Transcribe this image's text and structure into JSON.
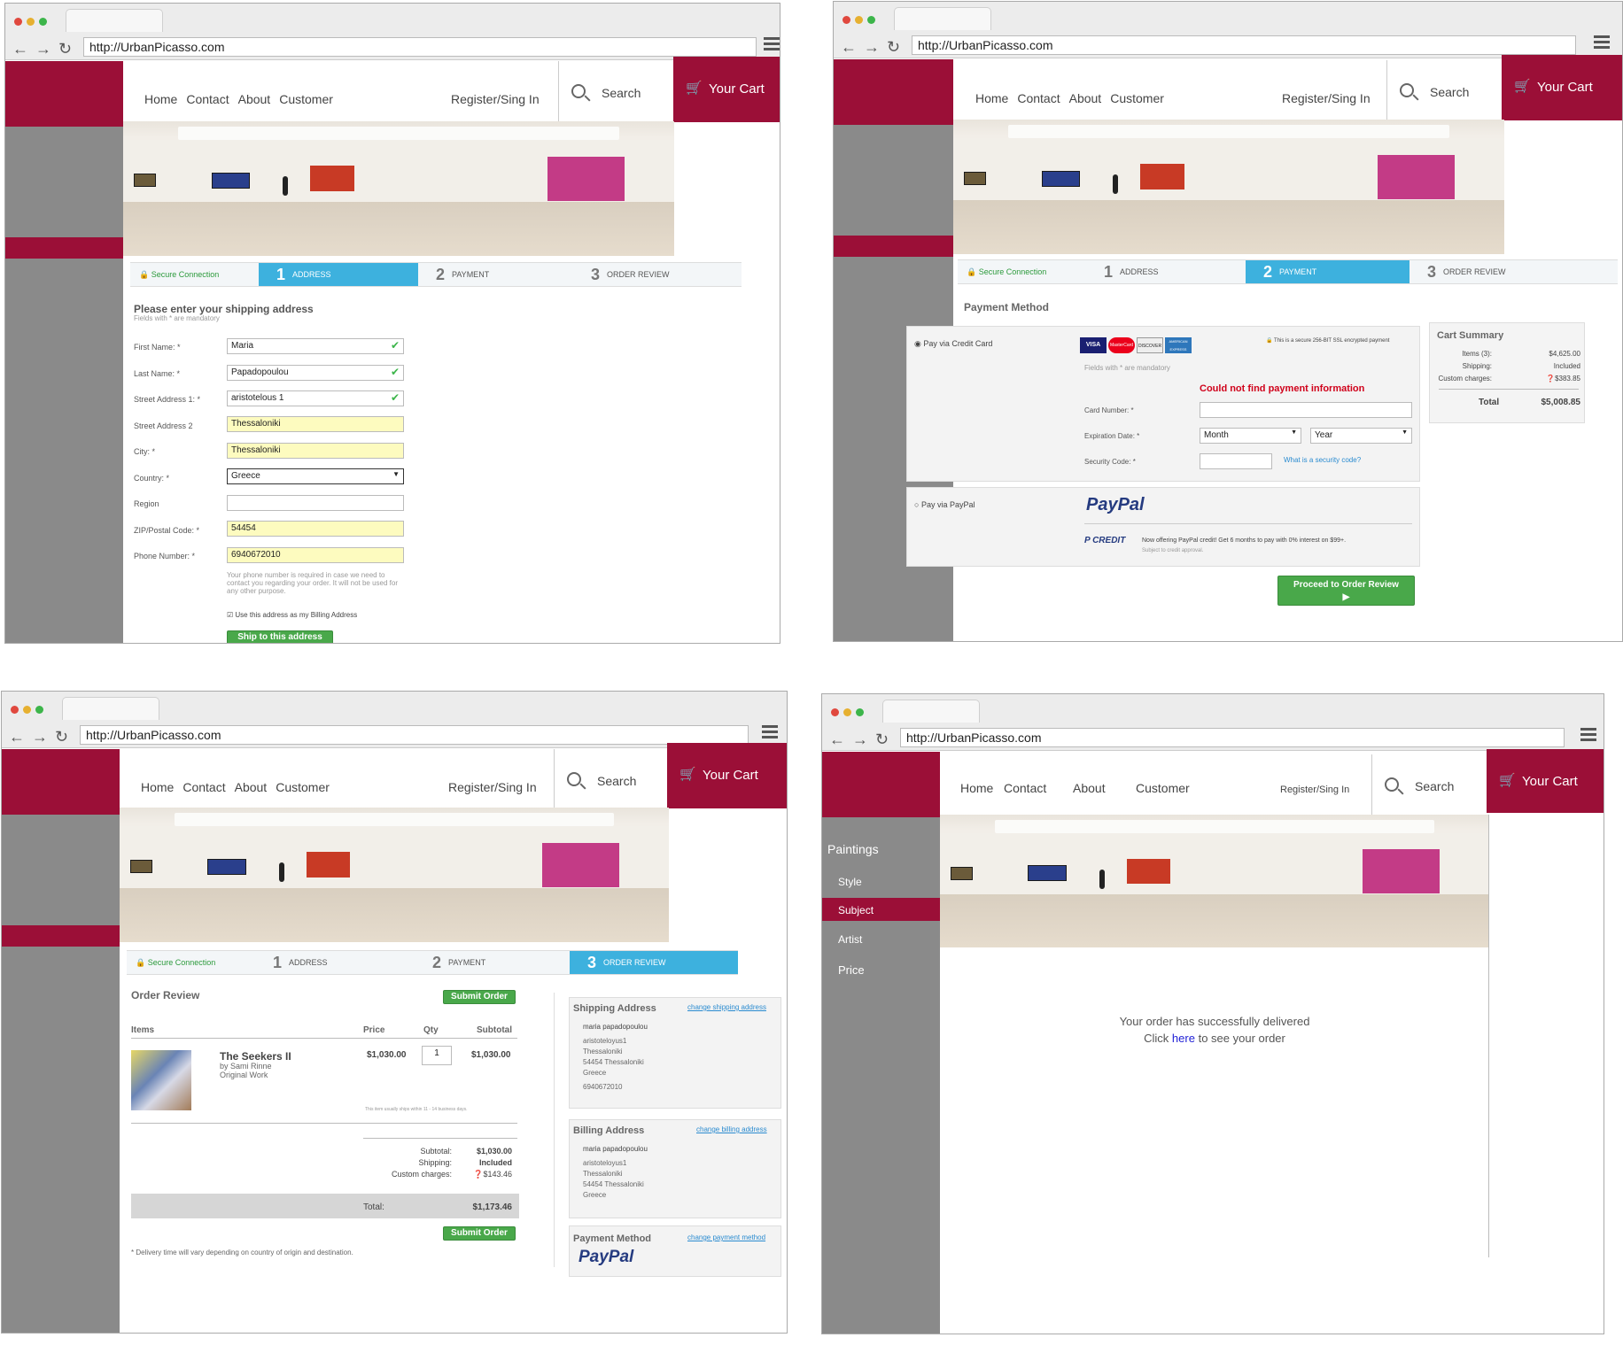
{
  "browser": {
    "url": "http://UrbanPicasso.com"
  },
  "site": {
    "nav": [
      "Home",
      "Contact",
      "About",
      "Customer"
    ],
    "register": "Register/Sing In",
    "search": "Search",
    "cart": "Your Cart",
    "cart_icon": "cart-icon",
    "brand_color": "#9b0f37",
    "accent_color": "#3db1de"
  },
  "steps": {
    "secure": "Secure Connection",
    "s1": "1",
    "l1": "ADDRESS",
    "s2": "2",
    "l2": "PAYMENT",
    "s3": "3",
    "l3": "ORDER REVIEW"
  },
  "address": {
    "title": "Please enter your shipping address",
    "subtitle": "Fields with * are mandatory",
    "fields": [
      {
        "label": "First Name: *",
        "value": "Maria"
      },
      {
        "label": "Last Name: *",
        "value": "Papadopoulou"
      },
      {
        "label": "Street Address 1: *",
        "value": "aristotelous 1"
      },
      {
        "label": "Street Address 2",
        "value": "Thessaloniki"
      },
      {
        "label": "City: *",
        "value": "Thessaloniki"
      },
      {
        "label": "Country: *",
        "value": "Greece"
      },
      {
        "label": "Region",
        "value": ""
      },
      {
        "label": "ZIP/Postal Code: *",
        "value": "54454"
      },
      {
        "label": "Phone Number: *",
        "value": "6940672010"
      }
    ],
    "phone_note": "Your phone number is required in case we need to contact you regarding your order. It will not be used for any other purpose.",
    "billing_check": "Use this address as my Billing Address",
    "ship_button": "Ship to this address"
  },
  "payment": {
    "title": "Payment Method",
    "credit_card": "Pay via Credit Card",
    "secure_note": "This is a secure 256-BIT SSL encrypted payment",
    "mandatory": "Fields with * are mandatory",
    "error": "Could not find payment information",
    "card_number": "Card Number: *",
    "expiration": "Expiration Date: *",
    "month": "Month",
    "year": "Year",
    "security": "Security Code: *",
    "security_link": "What is a security code?",
    "paypal": "Pay via PayPal",
    "paypal_logo": "PayPal",
    "paypal_credit": "CREDIT",
    "paypal_offer": "Now offering PayPal credit! Get 6 months to pay with 0% interest on $99+.",
    "paypal_sub": "Subject to credit approval.",
    "proceed": "Proceed to Order Review",
    "cards": [
      "VISA",
      "MasterCard",
      "DISCOVER",
      "AMERICAN EXPRESS"
    ]
  },
  "summary": {
    "title": "Cart Summary",
    "items_label": "Items (3):",
    "items_value": "$4,625.00",
    "shipping_label": "Shipping:",
    "shipping_value": "Included",
    "custom_label": "Custom charges:",
    "custom_value": "$383.85",
    "total_label": "Total",
    "total_value": "$5,008.85"
  },
  "review": {
    "title": "Order Review",
    "submit": "Submit Order",
    "col_items": "Items",
    "col_price": "Price",
    "col_qty": "Qty",
    "col_subtotal": "Subtotal",
    "item_name": "The Seekers II",
    "item_by": "by Sami Rinne",
    "item_kind": "Original Work",
    "item_price": "$1,030.00",
    "item_qty": "1",
    "item_subtotal": "$1,030.00",
    "ship_note": "This item usually ships within 11 - 14 business days.",
    "subtotal_label": "Subtotal:",
    "subtotal_value": "$1,030.00",
    "shipping_label": "Shipping:",
    "shipping_value": "Included",
    "custom_label": "Custom charges:",
    "custom_value": "$143.46",
    "total_label": "Total:",
    "total_value": "$1,173.46",
    "delivery_note": "* Delivery time will vary depending on country of origin and destination.",
    "ship_addr_title": "Shipping Address",
    "ship_addr_change": "change shipping address",
    "ship_addr_lines": [
      "maria papadopoulou",
      "aristoteloyus1",
      "Thessaloniki",
      "54454  Thessaloniki",
      "Greece",
      "6940672010"
    ],
    "bill_addr_title": "Billing Address",
    "bill_addr_change": "change billing address",
    "bill_addr_lines": [
      "maria papadopoulou",
      "aristoteloyus1",
      "Thessaloniki",
      "54454  Thessaloniki",
      "Greece"
    ],
    "pay_title": "Payment Method",
    "pay_change": "change payment method",
    "pay_logo": "PayPal"
  },
  "done": {
    "categories": [
      "Paintings",
      "Style",
      "Subject",
      "Artist",
      "Price"
    ],
    "message": "Your order has successfully delivered",
    "click": "Click",
    "here": "here",
    "rest": "to see your order"
  }
}
